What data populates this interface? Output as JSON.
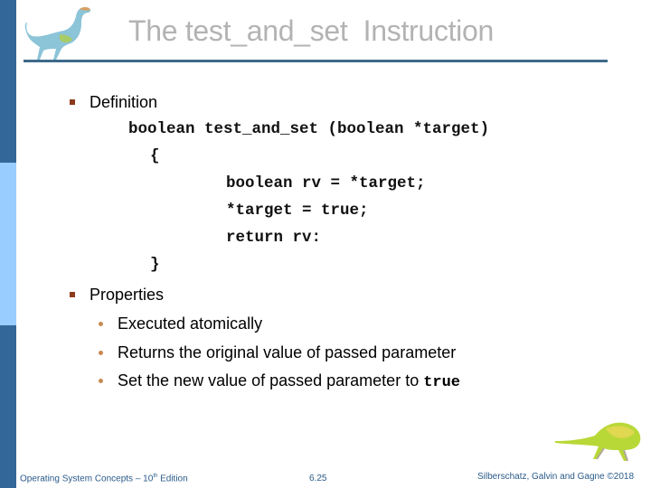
{
  "slide": {
    "title": "The test_and_set  Instruction",
    "sections": [
      {
        "label": "Definition",
        "code_lines": [
          "boolean test_and_set (boolean *target)",
          "{",
          "boolean rv = *target;",
          "*target = true;",
          "return rv:",
          "}"
        ]
      },
      {
        "label": "Properties",
        "items": [
          "Executed atomically",
          "Returns the original value of passed parameter",
          "Set the new value of passed parameter to "
        ],
        "last_item_code": "true"
      }
    ]
  },
  "footer": {
    "book_prefix": "Operating System Concepts – 10",
    "book_sup": "th",
    "book_suffix": " Edition",
    "page": "6.25",
    "authors": "Silberschatz, Galvin and Gagne ©2018"
  },
  "icons": {
    "top_left": "dinosaur-icon",
    "bottom_right": "dinosaur-icon"
  },
  "colors": {
    "sidebar_dark": "#336699",
    "sidebar_light": "#99ccff",
    "title": "#b3b3b3",
    "rule": "#3f6a8a",
    "footer": "#2a5a8a"
  }
}
